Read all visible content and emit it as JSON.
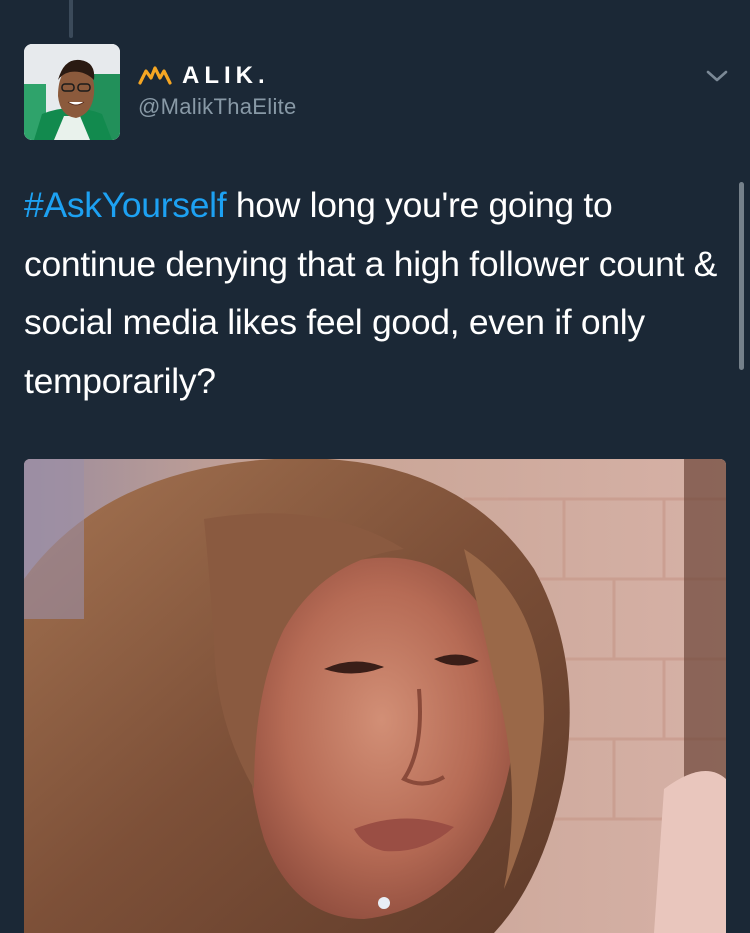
{
  "tweet": {
    "author": {
      "display_name": "ALIK.",
      "handle": "@MalikThaElite",
      "display_name_icon": "crown-icon",
      "avatar": "profile-photo"
    },
    "text": {
      "hashtag": "#AskYourself",
      "body": " how long you're going to continue denying that a high follower count & social media likes feel good, even if only temporarily?"
    },
    "menu_icon": "chevron-down-icon",
    "media": {
      "type": "gif-image"
    }
  },
  "colors": {
    "background": "#1b2836",
    "text_primary": "#ffffff",
    "text_secondary": "#8899a6",
    "link": "#1da1f2",
    "crown": "#f5a623"
  }
}
